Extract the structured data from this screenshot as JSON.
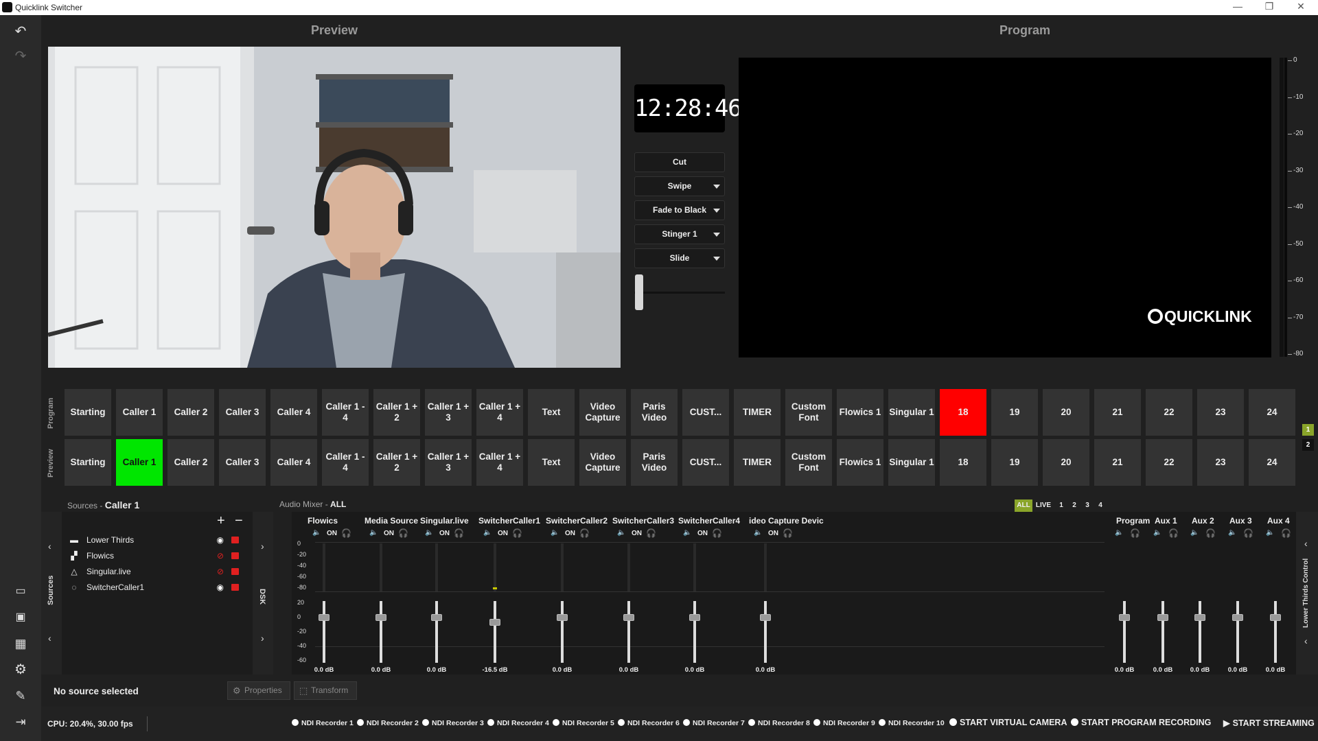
{
  "app": {
    "title": "Quicklink Switcher"
  },
  "headers": {
    "preview": "Preview",
    "program": "Program"
  },
  "clock": "12:28:46",
  "transitions": [
    {
      "label": "Cut",
      "dropdown": false
    },
    {
      "label": "Swipe",
      "dropdown": true
    },
    {
      "label": "Fade to Black",
      "dropdown": true
    },
    {
      "label": "Stinger 1",
      "dropdown": true
    },
    {
      "label": "Slide",
      "dropdown": true
    }
  ],
  "program_logo": "QUICKLINK",
  "meter_labels": [
    "0",
    "-10",
    "-20",
    "-30",
    "-40",
    "-50",
    "-60",
    "-70",
    "-80"
  ],
  "row_labels": {
    "program": "Program",
    "preview": "Preview"
  },
  "buttons": [
    "Starting",
    "Caller 1",
    "Caller 2",
    "Caller 3",
    "Caller 4",
    "Caller 1 - 4",
    "Caller 1 + 2",
    "Caller 1 + 3",
    "Caller 1 + 4",
    "Text",
    "Video Capture",
    "Paris Video",
    "CUST...",
    "TIMER",
    "Custom Font",
    "Flowics 1",
    "Singular 1",
    "18",
    "19",
    "20",
    "21",
    "22",
    "23",
    "24"
  ],
  "program_active_index": 17,
  "preview_active_index": 1,
  "colors": {
    "program_active": "#ff0000",
    "preview_active": "#00e600",
    "accent": "#8aa52a"
  },
  "side_pages": [
    "1",
    "2"
  ],
  "sources_header": {
    "title": "Sources",
    "sep": "-",
    "selected": "Caller 1"
  },
  "sources_tab": "Sources",
  "dsk_tab": "DSK",
  "sources": [
    {
      "name": "Lower Thirds",
      "icon": "lower-thirds-icon",
      "visible": true
    },
    {
      "name": "Flowics",
      "icon": "image-icon",
      "visible": false
    },
    {
      "name": "Singular.live",
      "icon": "singular-icon",
      "visible": false
    },
    {
      "name": "SwitcherCaller1",
      "icon": "caller-icon",
      "visible": true
    }
  ],
  "mixer_header": {
    "title": "Audio Mixer",
    "sep": "-",
    "filter": "ALL"
  },
  "mixer_tabs": [
    "ALL",
    "LIVE",
    "1",
    "2",
    "3",
    "4"
  ],
  "mixer_scale_top": [
    "0",
    "-20",
    "-40",
    "-60",
    "-80"
  ],
  "mixer_scale_bottom": [
    "20",
    "0",
    "-20",
    "-40",
    "-60"
  ],
  "channels": [
    {
      "name": "Flowics",
      "on": "ON",
      "db": "0.0 dB",
      "level": 0
    },
    {
      "name": "Media Source",
      "on": "ON",
      "db": "0.0 dB",
      "level": 0
    },
    {
      "name": "Singular.live",
      "on": "ON",
      "db": "0.0 dB",
      "level": 0
    },
    {
      "name": "SwitcherCaller1",
      "on": "ON",
      "db": "-16.5 dB",
      "level": -16.5
    },
    {
      "name": "SwitcherCaller2",
      "on": "ON",
      "db": "0.0 dB",
      "level": 0
    },
    {
      "name": "SwitcherCaller3",
      "on": "ON",
      "db": "0.0 dB",
      "level": 0
    },
    {
      "name": "SwitcherCaller4",
      "on": "ON",
      "db": "0.0 dB",
      "level": 0
    },
    {
      "name": "ideo Capture Devic",
      "on": "ON",
      "db": "0.0 dB",
      "level": 0
    }
  ],
  "aux_channels": [
    {
      "name": "Program",
      "db": "0.0 dB"
    },
    {
      "name": "Aux 1",
      "db": "0.0 dB"
    },
    {
      "name": "Aux 2",
      "db": "0.0 dB"
    },
    {
      "name": "Aux 3",
      "db": "0.0 dB"
    },
    {
      "name": "Aux 4",
      "db": "0.0 dB"
    }
  ],
  "lower_thirds_control": "Lower Thirds Control",
  "status": {
    "no_source": "No source selected",
    "cpu": "CPU: 20.4%, 30.00 fps"
  },
  "props_buttons": {
    "properties": "Properties",
    "transform": "Transform"
  },
  "recorders": [
    "NDI Recorder 1",
    "NDI Recorder 2",
    "NDI Recorder 3",
    "NDI Recorder 4",
    "NDI Recorder 5",
    "NDI Recorder 6",
    "NDI Recorder 7",
    "NDI Recorder 8",
    "NDI Recorder 9",
    "NDI Recorder 10"
  ],
  "actions": {
    "virtual_camera": "START VIRTUAL CAMERA",
    "program_recording": "START PROGRAM RECORDING",
    "streaming": "START STREAMING"
  }
}
